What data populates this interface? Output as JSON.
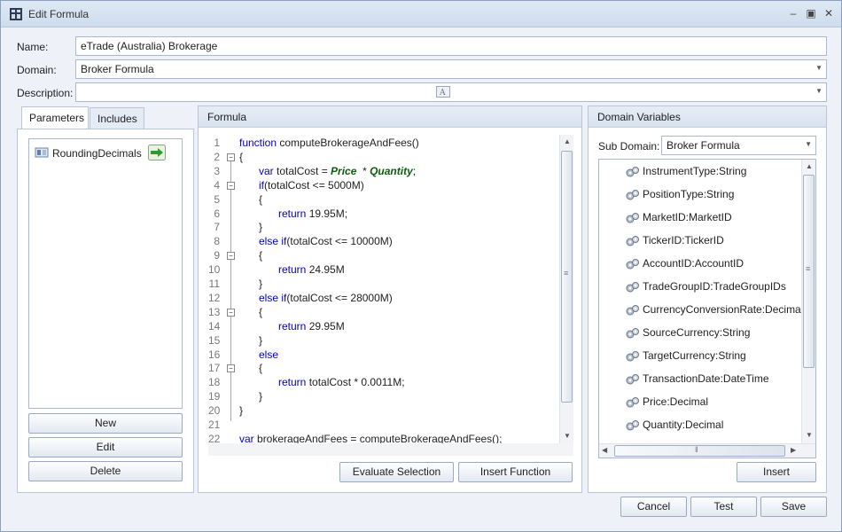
{
  "window": {
    "title": "Edit Formula",
    "controls": [
      "minimize",
      "maximize",
      "close"
    ]
  },
  "form": {
    "name_label": "Name:",
    "name_value": "eTrade (Australia) Brokerage",
    "domain_label": "Domain:",
    "domain_value": "Broker Formula",
    "description_label": "Description:",
    "description_value": ""
  },
  "left_panel": {
    "tabs": [
      "Parameters",
      "Includes"
    ],
    "active_tab": "Parameters",
    "parameters": [
      {
        "name": "RoundingDecimals"
      }
    ],
    "buttons": {
      "new": "New",
      "edit": "Edit",
      "delete": "Delete"
    }
  },
  "formula_panel": {
    "header": "Formula",
    "lines": [
      {
        "n": "1",
        "segments": [
          [
            "kw",
            "function "
          ],
          [
            "p",
            "computeBrokerageAndFees()"
          ]
        ],
        "indent": 35
      },
      {
        "n": "2",
        "segments": [
          [
            "p",
            "{"
          ]
        ],
        "indent": 35
      },
      {
        "n": "3",
        "segments": [
          [
            "kw",
            "var "
          ],
          [
            "p",
            "totalCost = "
          ],
          [
            "var",
            "Price"
          ],
          [
            "p",
            "  * "
          ],
          [
            "var",
            "Quantity"
          ],
          [
            "p",
            ";"
          ]
        ],
        "indent": 57
      },
      {
        "n": "4",
        "segments": [
          [
            "kw",
            "if"
          ],
          [
            "p",
            "(totalCost <= 5000M)"
          ]
        ],
        "indent": 57
      },
      {
        "n": "5",
        "segments": [
          [
            "p",
            "{"
          ]
        ],
        "indent": 57
      },
      {
        "n": "6",
        "segments": [
          [
            "kw",
            "return "
          ],
          [
            "p",
            "19.95M;"
          ]
        ],
        "indent": 79
      },
      {
        "n": "7",
        "segments": [
          [
            "p",
            "}"
          ]
        ],
        "indent": 57
      },
      {
        "n": "8",
        "segments": [
          [
            "kw",
            "else if"
          ],
          [
            "p",
            "(totalCost <= 10000M)"
          ]
        ],
        "indent": 57
      },
      {
        "n": "9",
        "segments": [
          [
            "p",
            "{"
          ]
        ],
        "indent": 57
      },
      {
        "n": "10",
        "segments": [
          [
            "kw",
            "return "
          ],
          [
            "p",
            "24.95M"
          ]
        ],
        "indent": 79
      },
      {
        "n": "11",
        "segments": [
          [
            "p",
            "}"
          ]
        ],
        "indent": 57
      },
      {
        "n": "12",
        "segments": [
          [
            "kw",
            "else if"
          ],
          [
            "p",
            "(totalCost <= 28000M)"
          ]
        ],
        "indent": 57
      },
      {
        "n": "13",
        "segments": [
          [
            "p",
            "{"
          ]
        ],
        "indent": 57
      },
      {
        "n": "14",
        "segments": [
          [
            "kw",
            "return "
          ],
          [
            "p",
            "29.95M"
          ]
        ],
        "indent": 79
      },
      {
        "n": "15",
        "segments": [
          [
            "p",
            "}"
          ]
        ],
        "indent": 57
      },
      {
        "n": "16",
        "segments": [
          [
            "kw",
            "else"
          ]
        ],
        "indent": 57
      },
      {
        "n": "17",
        "segments": [
          [
            "p",
            "{"
          ]
        ],
        "indent": 57
      },
      {
        "n": "18",
        "segments": [
          [
            "kw",
            "return "
          ],
          [
            "p",
            "totalCost * 0.0011M;"
          ]
        ],
        "indent": 79
      },
      {
        "n": "19",
        "segments": [
          [
            "p",
            "}"
          ]
        ],
        "indent": 57
      },
      {
        "n": "20",
        "segments": [
          [
            "p",
            "}"
          ]
        ],
        "indent": 35
      },
      {
        "n": "21",
        "segments": [],
        "indent": 35
      },
      {
        "n": "22",
        "segments": [
          [
            "kw",
            "var "
          ],
          [
            "p",
            "brokerageAndFees = computeBrokerageAndFees();"
          ]
        ],
        "indent": 35
      }
    ],
    "buttons": {
      "evaluate": "Evaluate Selection",
      "insert_function": "Insert Function"
    }
  },
  "domain_panel": {
    "header": "Domain Variables",
    "sub_domain_label": "Sub Domain:",
    "sub_domain_value": "Broker Formula",
    "variables": [
      "InstrumentType:String",
      "PositionType:String",
      "MarketID:MarketID",
      "TickerID:TickerID",
      "AccountID:AccountID",
      "TradeGroupID:TradeGroupIDs",
      "CurrencyConversionRate:Decimal",
      "SourceCurrency:String",
      "TargetCurrency:String",
      "TransactionDate:DateTime",
      "Price:Decimal",
      "Quantity:Decimal"
    ],
    "insert_button": "Insert"
  },
  "footer": {
    "cancel": "Cancel",
    "test": "Test",
    "save": "Save"
  },
  "colors": {
    "keyword": "#0000cc",
    "variable": "#0b5e0b",
    "accent": "#4a7ab5"
  }
}
